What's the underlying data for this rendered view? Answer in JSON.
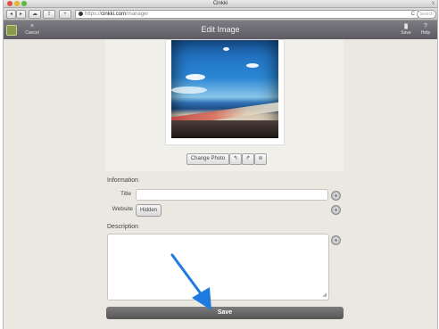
{
  "window": {
    "title": "Cinkki",
    "close_glyph": "x"
  },
  "browser": {
    "url_prefix": "https://",
    "url_domain": "cinkki.com",
    "url_path": "/manager",
    "back_glyph": "◂",
    "forward_glyph": "▸",
    "reader_glyph": "☁",
    "share_glyph": "⇪",
    "add_glyph": "+",
    "reload_glyph": "C",
    "search_placeholder": "Search"
  },
  "app": {
    "title": "Edit Image",
    "cancel_label": "Cancel",
    "cancel_icon": "×",
    "save_label": "Save",
    "save_icon": "▐▌",
    "help_label": "Help",
    "help_icon": "?"
  },
  "photo_tools": {
    "change_photo": "Change Photo",
    "rotate_left": "↰",
    "rotate_right": "↱",
    "adjust": "≋"
  },
  "information": {
    "heading": "Information",
    "title_label": "Title",
    "title_value": "",
    "website_label": "Website",
    "website_button": "Hidden"
  },
  "description": {
    "heading": "Description",
    "value": "",
    "grip": "◢"
  },
  "save_button": "Save",
  "colors": {
    "arrow": "#1f7be0",
    "header": "#6a696e",
    "background": "#ebe8e1"
  }
}
